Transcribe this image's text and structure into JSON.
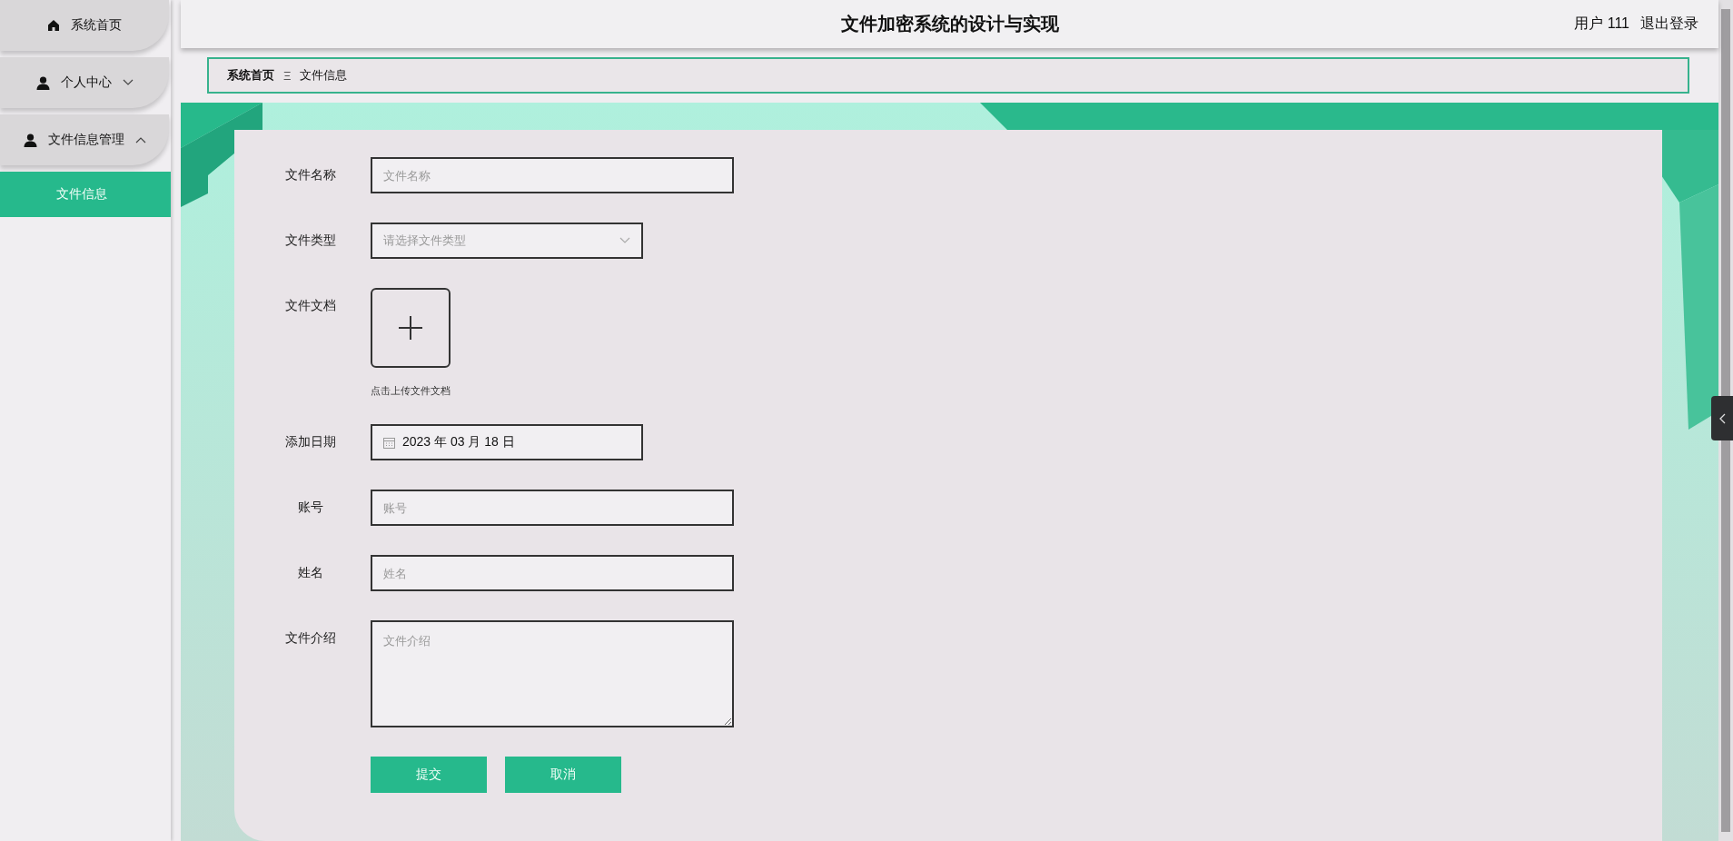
{
  "sidebar": {
    "items": [
      {
        "label": "系统首页"
      },
      {
        "label": "个人中心",
        "expanded": false
      },
      {
        "label": "文件信息管理",
        "expanded": true,
        "children": [
          {
            "label": "文件信息",
            "selected": true
          }
        ]
      }
    ]
  },
  "header": {
    "title": "文件加密系统的设计与实现",
    "user": "用户 111",
    "logout": "退出登录"
  },
  "breadcrumb": [
    {
      "label": "系统首页",
      "current": false
    },
    {
      "label": "文件信息",
      "current": true
    }
  ],
  "breadcrumb_separator": "Ξ",
  "form": {
    "fields": [
      {
        "kind": "text",
        "label": "文件名称",
        "placeholder": "文件名称"
      },
      {
        "kind": "select",
        "label": "文件类型",
        "placeholder": "请选择文件类型"
      },
      {
        "kind": "upload",
        "label": "文件文档",
        "hint": "点击上传文件文档"
      },
      {
        "kind": "date",
        "label": "添加日期",
        "value": "2023 年 03 月 18 日"
      },
      {
        "kind": "text",
        "label": "账号",
        "placeholder": "账号"
      },
      {
        "kind": "text",
        "label": "姓名",
        "placeholder": "姓名"
      },
      {
        "kind": "textarea",
        "label": "文件介绍",
        "placeholder": "文件介绍"
      }
    ],
    "buttons": [
      "提交",
      "取消"
    ]
  }
}
